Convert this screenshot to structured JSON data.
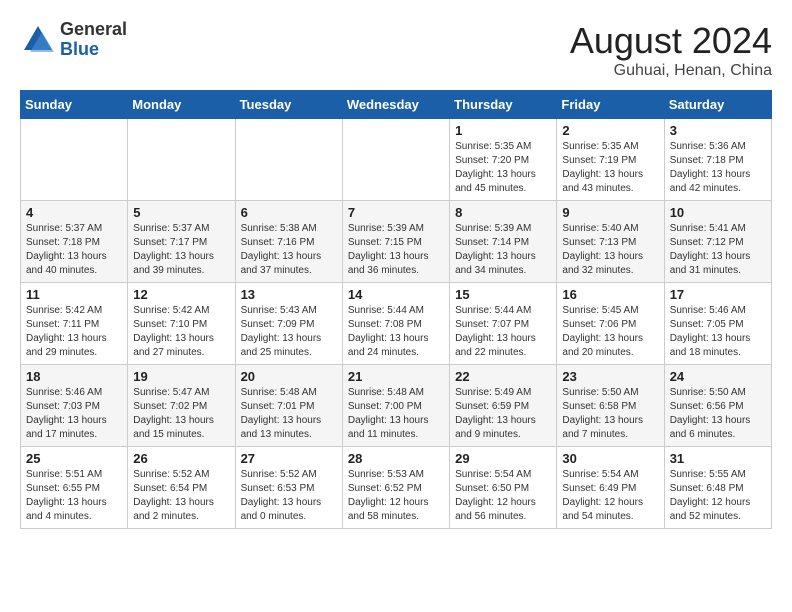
{
  "header": {
    "logo_general": "General",
    "logo_blue": "Blue",
    "title": "August 2024",
    "location": "Guhuai, Henan, China"
  },
  "weekdays": [
    "Sunday",
    "Monday",
    "Tuesday",
    "Wednesday",
    "Thursday",
    "Friday",
    "Saturday"
  ],
  "weeks": [
    [
      {
        "day": "",
        "info": ""
      },
      {
        "day": "",
        "info": ""
      },
      {
        "day": "",
        "info": ""
      },
      {
        "day": "",
        "info": ""
      },
      {
        "day": "1",
        "info": "Sunrise: 5:35 AM\nSunset: 7:20 PM\nDaylight: 13 hours\nand 45 minutes."
      },
      {
        "day": "2",
        "info": "Sunrise: 5:35 AM\nSunset: 7:19 PM\nDaylight: 13 hours\nand 43 minutes."
      },
      {
        "day": "3",
        "info": "Sunrise: 5:36 AM\nSunset: 7:18 PM\nDaylight: 13 hours\nand 42 minutes."
      }
    ],
    [
      {
        "day": "4",
        "info": "Sunrise: 5:37 AM\nSunset: 7:18 PM\nDaylight: 13 hours\nand 40 minutes."
      },
      {
        "day": "5",
        "info": "Sunrise: 5:37 AM\nSunset: 7:17 PM\nDaylight: 13 hours\nand 39 minutes."
      },
      {
        "day": "6",
        "info": "Sunrise: 5:38 AM\nSunset: 7:16 PM\nDaylight: 13 hours\nand 37 minutes."
      },
      {
        "day": "7",
        "info": "Sunrise: 5:39 AM\nSunset: 7:15 PM\nDaylight: 13 hours\nand 36 minutes."
      },
      {
        "day": "8",
        "info": "Sunrise: 5:39 AM\nSunset: 7:14 PM\nDaylight: 13 hours\nand 34 minutes."
      },
      {
        "day": "9",
        "info": "Sunrise: 5:40 AM\nSunset: 7:13 PM\nDaylight: 13 hours\nand 32 minutes."
      },
      {
        "day": "10",
        "info": "Sunrise: 5:41 AM\nSunset: 7:12 PM\nDaylight: 13 hours\nand 31 minutes."
      }
    ],
    [
      {
        "day": "11",
        "info": "Sunrise: 5:42 AM\nSunset: 7:11 PM\nDaylight: 13 hours\nand 29 minutes."
      },
      {
        "day": "12",
        "info": "Sunrise: 5:42 AM\nSunset: 7:10 PM\nDaylight: 13 hours\nand 27 minutes."
      },
      {
        "day": "13",
        "info": "Sunrise: 5:43 AM\nSunset: 7:09 PM\nDaylight: 13 hours\nand 25 minutes."
      },
      {
        "day": "14",
        "info": "Sunrise: 5:44 AM\nSunset: 7:08 PM\nDaylight: 13 hours\nand 24 minutes."
      },
      {
        "day": "15",
        "info": "Sunrise: 5:44 AM\nSunset: 7:07 PM\nDaylight: 13 hours\nand 22 minutes."
      },
      {
        "day": "16",
        "info": "Sunrise: 5:45 AM\nSunset: 7:06 PM\nDaylight: 13 hours\nand 20 minutes."
      },
      {
        "day": "17",
        "info": "Sunrise: 5:46 AM\nSunset: 7:05 PM\nDaylight: 13 hours\nand 18 minutes."
      }
    ],
    [
      {
        "day": "18",
        "info": "Sunrise: 5:46 AM\nSunset: 7:03 PM\nDaylight: 13 hours\nand 17 minutes."
      },
      {
        "day": "19",
        "info": "Sunrise: 5:47 AM\nSunset: 7:02 PM\nDaylight: 13 hours\nand 15 minutes."
      },
      {
        "day": "20",
        "info": "Sunrise: 5:48 AM\nSunset: 7:01 PM\nDaylight: 13 hours\nand 13 minutes."
      },
      {
        "day": "21",
        "info": "Sunrise: 5:48 AM\nSunset: 7:00 PM\nDaylight: 13 hours\nand 11 minutes."
      },
      {
        "day": "22",
        "info": "Sunrise: 5:49 AM\nSunset: 6:59 PM\nDaylight: 13 hours\nand 9 minutes."
      },
      {
        "day": "23",
        "info": "Sunrise: 5:50 AM\nSunset: 6:58 PM\nDaylight: 13 hours\nand 7 minutes."
      },
      {
        "day": "24",
        "info": "Sunrise: 5:50 AM\nSunset: 6:56 PM\nDaylight: 13 hours\nand 6 minutes."
      }
    ],
    [
      {
        "day": "25",
        "info": "Sunrise: 5:51 AM\nSunset: 6:55 PM\nDaylight: 13 hours\nand 4 minutes."
      },
      {
        "day": "26",
        "info": "Sunrise: 5:52 AM\nSunset: 6:54 PM\nDaylight: 13 hours\nand 2 minutes."
      },
      {
        "day": "27",
        "info": "Sunrise: 5:52 AM\nSunset: 6:53 PM\nDaylight: 13 hours\nand 0 minutes."
      },
      {
        "day": "28",
        "info": "Sunrise: 5:53 AM\nSunset: 6:52 PM\nDaylight: 12 hours\nand 58 minutes."
      },
      {
        "day": "29",
        "info": "Sunrise: 5:54 AM\nSunset: 6:50 PM\nDaylight: 12 hours\nand 56 minutes."
      },
      {
        "day": "30",
        "info": "Sunrise: 5:54 AM\nSunset: 6:49 PM\nDaylight: 12 hours\nand 54 minutes."
      },
      {
        "day": "31",
        "info": "Sunrise: 5:55 AM\nSunset: 6:48 PM\nDaylight: 12 hours\nand 52 minutes."
      }
    ]
  ]
}
